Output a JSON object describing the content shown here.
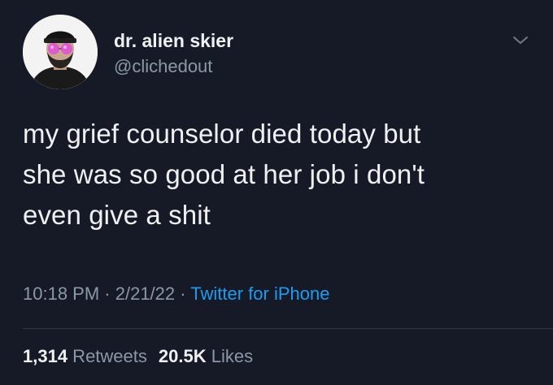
{
  "user": {
    "display_name": "dr. alien skier",
    "handle": "@clichedout",
    "avatar_icon": "profile-avatar"
  },
  "tweet": {
    "lines": [
      "my grief counselor died today but",
      "she was so good at her job i don't",
      "even give a shit"
    ]
  },
  "meta": {
    "time": "10:18 PM",
    "separator1": " · ",
    "date": "2/21/22",
    "separator2": " · ",
    "source": "Twitter for iPhone"
  },
  "stats": {
    "retweets_count": "1,314",
    "retweets_label": " Retweets",
    "likes_count": "20.5K",
    "likes_label": " Likes"
  },
  "icons": {
    "menu": "chevron-down-icon"
  },
  "colors": {
    "background": "#151a26",
    "text": "#eef0f2",
    "muted": "#8b98a5",
    "link": "#1d9bf0"
  }
}
